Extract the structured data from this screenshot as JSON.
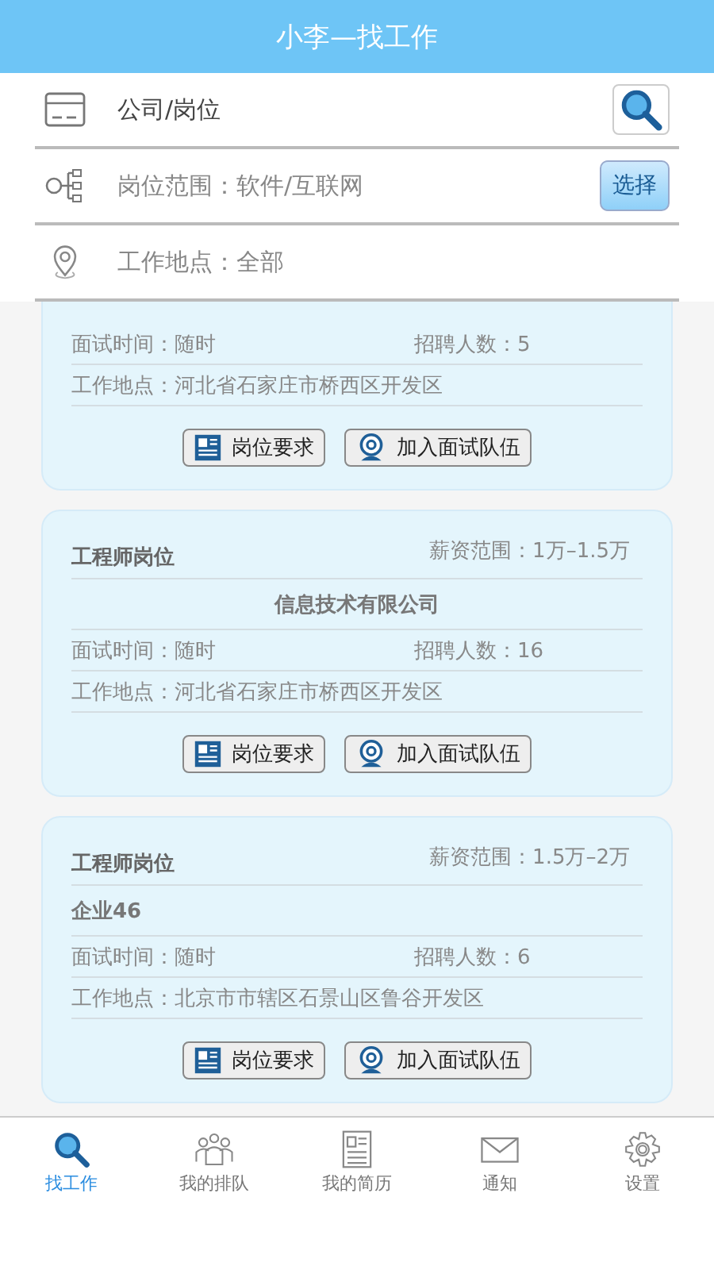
{
  "title": "小李—找工作",
  "filters": [
    {
      "kind": "search",
      "text": "公司/岗位"
    },
    {
      "kind": "category",
      "text": "岗位范围：软件/互联网",
      "button": "选择"
    },
    {
      "kind": "location",
      "text": "工作地点：全部"
    }
  ],
  "jobs": [
    {
      "interview": "面试时间：随时",
      "headcount": "招聘人数：5",
      "location": "工作地点：河北省石家庄市桥西区开发区",
      "buttons": [
        "岗位要求",
        "加入面试队伍"
      ]
    },
    {
      "title": "工程师岗位",
      "salary": "薪资范围：1万–1.5万",
      "company": "信息技术有限公司",
      "company_centered": true,
      "interview": "面试时间：随时",
      "headcount": "招聘人数：16",
      "location": "工作地点：河北省石家庄市桥西区开发区",
      "buttons": [
        "岗位要求",
        "加入面试队伍"
      ]
    },
    {
      "title": "工程师岗位",
      "salary": "薪资范围：1.5万–2万",
      "company": "企业46",
      "company_centered": false,
      "interview": "面试时间：随时",
      "headcount": "招聘人数：6",
      "location": "工作地点：北京市市辖区石景山区鲁谷开发区",
      "buttons": [
        "岗位要求",
        "加入面试队伍"
      ]
    }
  ],
  "tabs": [
    {
      "kind": "search",
      "label": "找工作",
      "selected": true
    },
    {
      "kind": "people",
      "label": "我的排队",
      "selected": false
    },
    {
      "kind": "resume",
      "label": "我的简历",
      "selected": false
    },
    {
      "kind": "mail",
      "label": "通知",
      "selected": false
    },
    {
      "kind": "gear",
      "label": "设置",
      "selected": false
    }
  ]
}
